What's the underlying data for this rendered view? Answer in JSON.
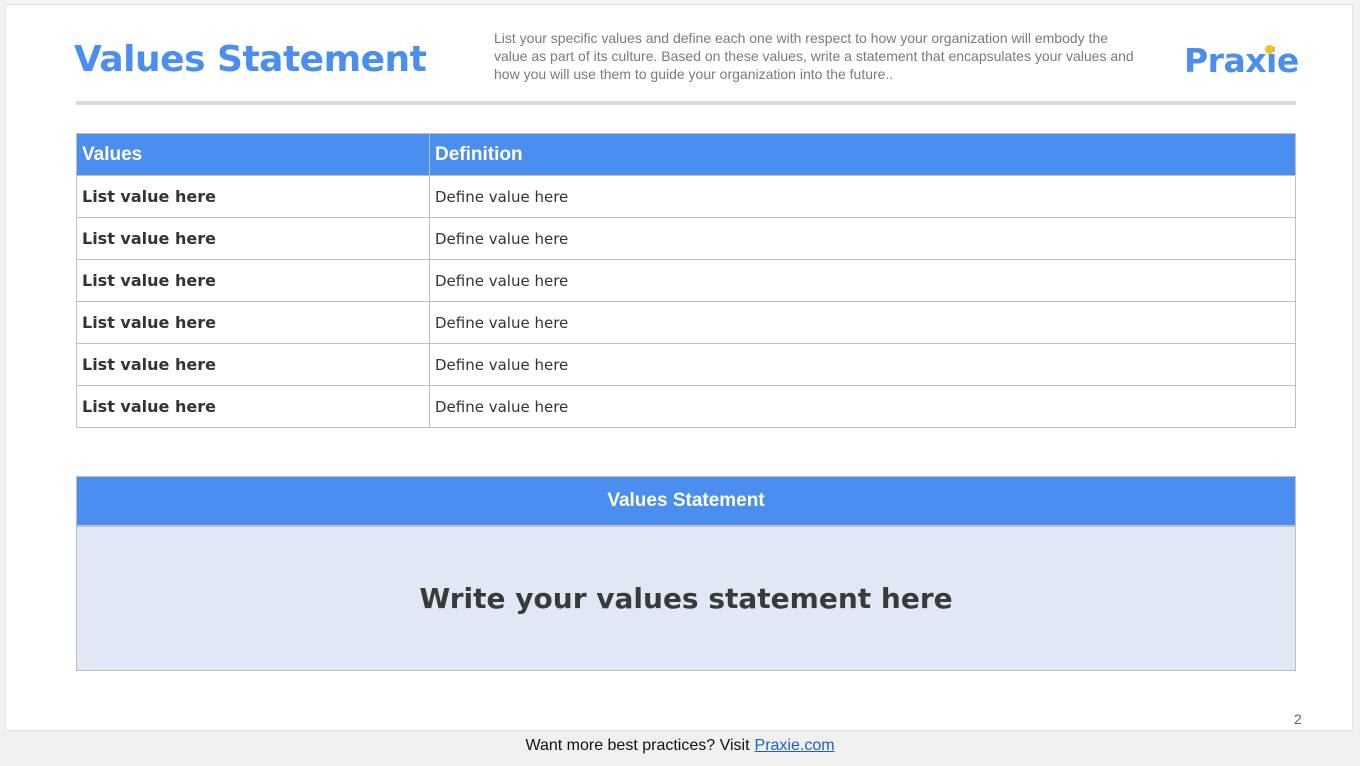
{
  "header": {
    "title": "Values Statement",
    "intro": "List your specific values and define each one with respect to how your organization will embody the value as part of its culture. Based on these values, write a statement that encapsulates your values and how you will use them to guide your organization into the future..",
    "logo_text": "Praxie"
  },
  "table": {
    "headers": [
      "Values",
      "Definition"
    ],
    "rows": [
      {
        "value": "List value here",
        "definition": "Define value here"
      },
      {
        "value": "List value here",
        "definition": "Define value here"
      },
      {
        "value": "List value here",
        "definition": "Define value here"
      },
      {
        "value": "List value here",
        "definition": "Define value here"
      },
      {
        "value": "List value here",
        "definition": "Define value here"
      },
      {
        "value": "List value here",
        "definition": "Define value here"
      }
    ]
  },
  "statement": {
    "header": "Values Statement",
    "placeholder": "Write your values statement here"
  },
  "page_number": "2",
  "footer": {
    "text": "Want more best practices? Visit",
    "link": "Praxie.com"
  },
  "colors": {
    "accent": "#4a8ef0",
    "statement_bg": "#dfe9f5",
    "logo_dot": "#f3c21c"
  }
}
